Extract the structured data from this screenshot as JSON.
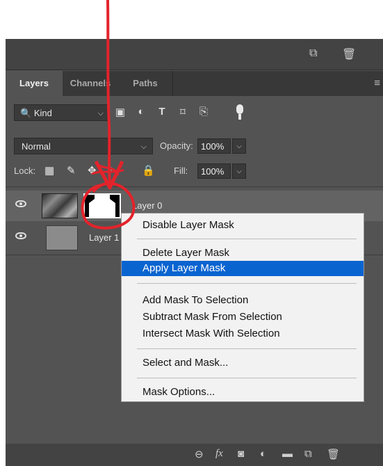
{
  "tabs": {
    "layers": "Layers",
    "channels": "Channels",
    "paths": "Paths"
  },
  "filter": {
    "kind_label": "Kind",
    "icons": [
      "image-filter-icon",
      "adjustment-filter-icon",
      "type-filter-icon",
      "shape-filter-icon",
      "smart-object-filter-icon",
      "filter-toggle-icon"
    ]
  },
  "blend": {
    "mode": "Normal",
    "opacity_label": "Opacity:",
    "opacity_value": "100%"
  },
  "lock": {
    "label": "Lock:",
    "fill_label": "Fill:",
    "fill_value": "100%"
  },
  "layers": [
    {
      "name": "Layer 0"
    },
    {
      "name": "Layer 1"
    }
  ],
  "context_menu": {
    "items": [
      "Disable Layer Mask",
      "Delete Layer Mask",
      "Apply Layer Mask",
      "Add Mask To Selection",
      "Subtract Mask From Selection",
      "Intersect Mask With Selection",
      "Select and Mask...",
      "Mask Options..."
    ],
    "highlighted": "Apply Layer Mask"
  },
  "bottom_icons": [
    "link-icon",
    "fx-icon",
    "add-mask-icon",
    "adjustment-layer-icon",
    "folder-icon",
    "new-layer-icon",
    "trash-icon"
  ],
  "colors": {
    "panel_bg": "#535353",
    "menu_highlight": "#0a64d0",
    "annotation_red": "#e3232b"
  }
}
